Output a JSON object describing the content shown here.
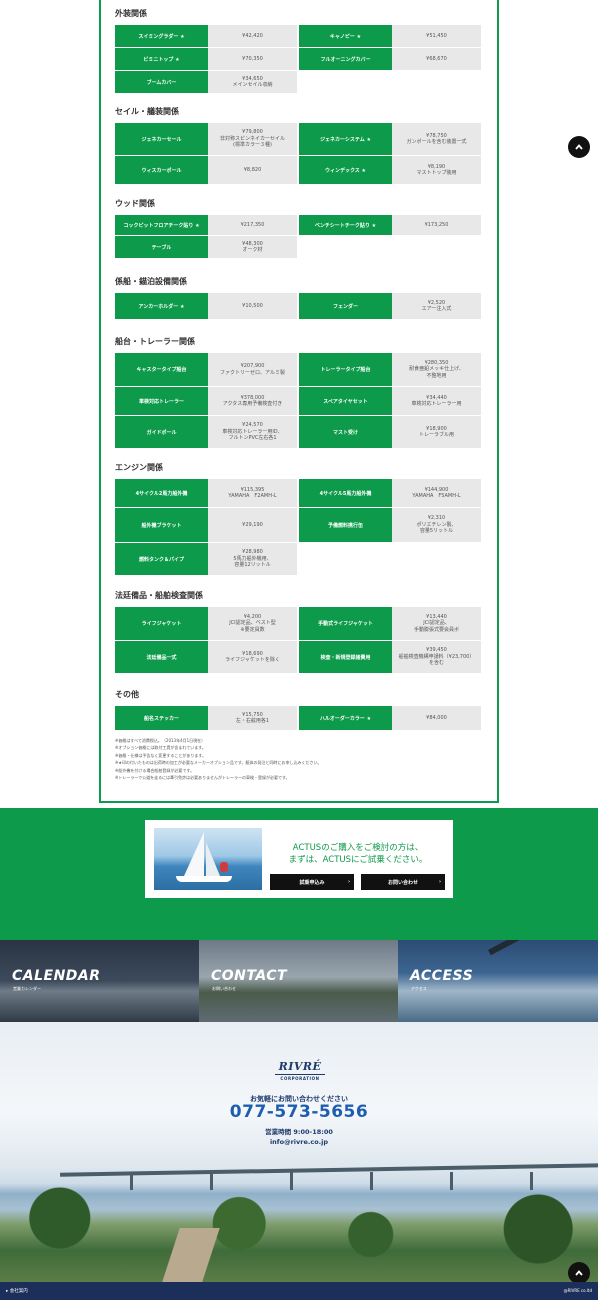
{
  "sections": [
    {
      "title": "外装関係",
      "rows": [
        [
          {
            "name": "スイミングラダー ★",
            "value": "¥42,420"
          },
          {
            "name": "キャノピー ★",
            "value": "¥51,450"
          }
        ],
        [
          {
            "name": "ビミニトップ ★",
            "value": "¥70,350"
          },
          {
            "name": "フルオーニングカバー",
            "value": "¥68,670"
          }
        ],
        [
          {
            "name": "ブームカバー",
            "value": "¥34,650\nメインセイル収納"
          }
        ]
      ]
    },
    {
      "title": "セイル・艤装関係",
      "rows": [
        [
          {
            "name": "ジェネカーセール",
            "value": "¥79,800\n非対称スピンネイカーセイル\n(標準カラー３種)"
          },
          {
            "name": "ジェネカーシステム ★",
            "value": "¥78,750\nガンポールを含む装置一式"
          }
        ],
        [
          {
            "name": "ウィスカーポール",
            "value": "¥8,820"
          },
          {
            "name": "ウィンデックス ★",
            "value": "¥8,190\nマストトップ装用"
          }
        ]
      ]
    },
    {
      "title": "ウッド関係",
      "rows": [
        [
          {
            "name": "コックピットフロアチーク貼り ★",
            "value": "¥217,350"
          },
          {
            "name": "ベンチシートチーク貼り ★",
            "value": "¥173,250"
          }
        ],
        [
          {
            "name": "テーブル",
            "value": "¥48,300\nオーク材"
          }
        ]
      ]
    },
    {
      "title": "係船・錨泊設備関係",
      "rows": [
        [
          {
            "name": "アンカーホルダー ★",
            "value": "¥10,500"
          },
          {
            "name": "フェンダー",
            "value": "¥2,520\nエアー注入式"
          }
        ]
      ]
    },
    {
      "title": "船台・トレーラー関係",
      "rows": [
        [
          {
            "name": "キャスタータイプ船台",
            "value": "¥207,900\nファクトリーゼロ、アルミ製"
          },
          {
            "name": "トレーラータイプ船台",
            "value": "¥280,350\n耐食亜鉛メッキ仕上げ、\n不整地用"
          }
        ],
        [
          {
            "name": "車検対応トレーラー",
            "value": "¥378,000\nアクタス専用予備検査付き"
          },
          {
            "name": "スペアタイヤセット",
            "value": "¥34,440\n車検対応トレーラー用"
          }
        ],
        [
          {
            "name": "ガイドポール",
            "value": "¥24,570\n車検対応トレーラー用ID、\nフルトンPVC左右各1"
          },
          {
            "name": "マスト受け",
            "value": "¥18,900\nトレーラブル用"
          }
        ]
      ]
    },
    {
      "title": "エンジン関係",
      "rows": [
        [
          {
            "name": "4サイクル2馬力船外機",
            "value": "¥115,395\nYAMAHA　F2AMH-L"
          },
          {
            "name": "4サイクル5馬力船外機",
            "value": "¥144,900\nYAMAHA　F5AMH-L"
          }
        ],
        [
          {
            "name": "船外機ブラケット",
            "value": "¥29,190"
          },
          {
            "name": "予備燃料携行缶",
            "value": "¥2,310\nポリエチレン製、\n容量5リットル"
          }
        ],
        [
          {
            "name": "燃料タンク＆パイプ",
            "value": "¥28,980\n5馬力船外機用、\n容量12リットル"
          }
        ]
      ]
    },
    {
      "title": "法廷備品・船舶検査関係",
      "rows": [
        [
          {
            "name": "ライフジャケット",
            "value": "¥4,200\nJCI認定品、ベスト型\n※要定員数"
          },
          {
            "name": "手動式ライフジャケット",
            "value": "¥13,440\nJCI認定品、\n手動膨張式要会員ボ"
          }
        ],
        [
          {
            "name": "法廷備品一式",
            "value": "¥18,690\nライフジャケットを除く"
          },
          {
            "name": "検査・新規登録諸費用",
            "value": "¥39,450\n船舶検査機構申請料（¥23,700）\nを含む"
          }
        ]
      ]
    },
    {
      "title": "その他",
      "rows": [
        [
          {
            "name": "船名ステッカー",
            "value": "¥15,750\n左・右舷用各1"
          },
          {
            "name": "ハルオーダーカラー ★",
            "value": "¥84,000"
          }
        ]
      ]
    }
  ],
  "notes": "※価格はすべて消費税込。（2013年4月1日現在）\n※オプション価格には取付工賃が含まれています。\n※価格・仕様は予告なく変更することがあります。\n※★印の付いたものは出荷時の加工が必要なメーカーオプション品です。艇体の発注と同時にお申し込みください。\n※船外機を付ける場合船舶登録が必要です。\n※トレーラーで公道を走るには牽引免許は必要ありませんがトレーラーの車検・登録が必要です。",
  "cta": {
    "line1": "ACTUSのご購入をご検討の方は、",
    "line2": "まずは、ACTUSにご試乗ください。",
    "trial_button": "試乗申込み",
    "contact_button": "お問い合わせ",
    "arrow": "›"
  },
  "banners": [
    {
      "title": "CALENDAR",
      "sub": "営業カレンダー"
    },
    {
      "title": "CONTACT",
      "sub": "お問い合わせ"
    },
    {
      "title": "ACCESS",
      "sub": "アクセス"
    }
  ],
  "footer": {
    "logo_main": "RIVRÉ",
    "logo_sub": "CORPORATION",
    "lead": "お気軽にお問い合わせください",
    "tel": "077-573-5656",
    "hours": "営業時間 9:00-18:00",
    "email": "info@rivre.co.jp",
    "company_link": "▸ 会社案内",
    "copyright": "@RIVRE co.ltd"
  },
  "colors": {
    "green": "#0d9a4a",
    "navy": "#1c2f5a",
    "cell_gray": "#e8e8e8"
  }
}
